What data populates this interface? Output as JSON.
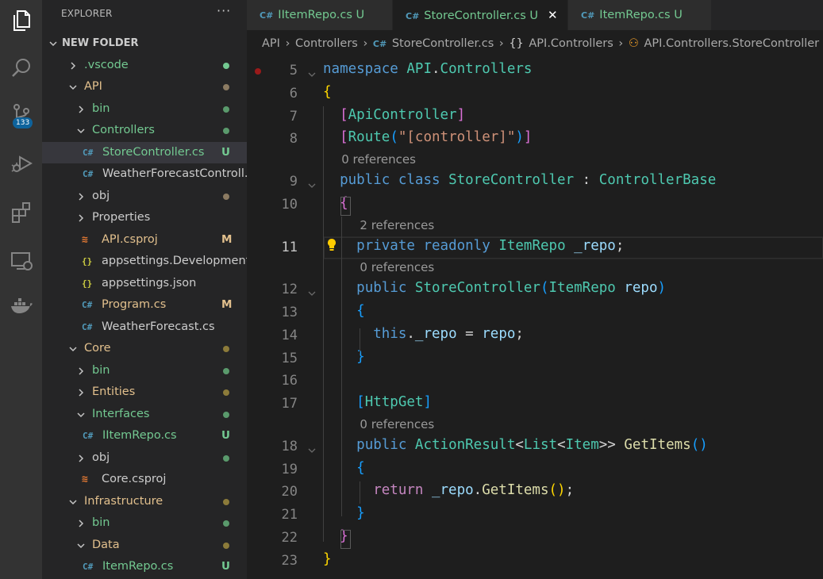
{
  "colors": {
    "git_untracked": "#73c991",
    "git_modified": "#e2c08d",
    "git_ignored": "#8c8c8c",
    "cs_icon": "#519aba",
    "xml_icon": "#e37933",
    "json_icon": "#cbcb41",
    "badge": "#0e639c"
  },
  "activity": {
    "source_control_badge": "133"
  },
  "sidebar": {
    "title": "EXPLORER",
    "more": "···",
    "rows": [
      {
        "label": "NEW FOLDER",
        "kind": "root",
        "depth": 0,
        "chev": "down"
      },
      {
        "label": ".vscode",
        "kind": "folder",
        "depth": 1,
        "chev": "right",
        "color": "#73c991",
        "dot": "#73c991"
      },
      {
        "label": "API",
        "kind": "folder",
        "depth": 1,
        "chev": "down",
        "color": "#e2c08d",
        "dot": "#8c7b62"
      },
      {
        "label": "bin",
        "kind": "folder",
        "depth": 2,
        "chev": "right",
        "color": "#73c991",
        "dot": "#5a9a6c"
      },
      {
        "label": "Controllers",
        "kind": "folder",
        "depth": 2,
        "chev": "down",
        "color": "#73c991",
        "dot": "#5a9a6c"
      },
      {
        "label": "StoreController.cs",
        "kind": "cs",
        "depth": 3,
        "color": "#73c991",
        "status": "U",
        "selected": true
      },
      {
        "label": "WeatherForecastControll...",
        "kind": "cs",
        "depth": 3,
        "color": "#cccccc"
      },
      {
        "label": "obj",
        "kind": "folder",
        "depth": 2,
        "chev": "right",
        "color": "#cccccc",
        "dot": "#8c7b62"
      },
      {
        "label": "Properties",
        "kind": "folder",
        "depth": 2,
        "chev": "right",
        "color": "#cccccc"
      },
      {
        "label": "API.csproj",
        "kind": "xml",
        "depth": 2,
        "color": "#e2c08d",
        "status": "M"
      },
      {
        "label": "appsettings.Development.j...",
        "kind": "json",
        "depth": 2,
        "color": "#cccccc"
      },
      {
        "label": "appsettings.json",
        "kind": "json",
        "depth": 2,
        "color": "#cccccc"
      },
      {
        "label": "Program.cs",
        "kind": "cs",
        "depth": 2,
        "color": "#e2c08d",
        "status": "M"
      },
      {
        "label": "WeatherForecast.cs",
        "kind": "cs",
        "depth": 2,
        "color": "#cccccc"
      },
      {
        "label": "Core",
        "kind": "folder",
        "depth": 1,
        "chev": "down",
        "color": "#e2c08d",
        "dot": "#8c7b3a"
      },
      {
        "label": "bin",
        "kind": "folder",
        "depth": 2,
        "chev": "right",
        "color": "#73c991",
        "dot": "#5a9a6c"
      },
      {
        "label": "Entities",
        "kind": "folder",
        "depth": 2,
        "chev": "right",
        "color": "#e2c08d",
        "dot": "#8c7b3a"
      },
      {
        "label": "Interfaces",
        "kind": "folder",
        "depth": 2,
        "chev": "down",
        "color": "#73c991",
        "dot": "#5a9a6c"
      },
      {
        "label": "IItemRepo.cs",
        "kind": "cs",
        "depth": 3,
        "color": "#73c991",
        "status": "U"
      },
      {
        "label": "obj",
        "kind": "folder",
        "depth": 2,
        "chev": "right",
        "color": "#cccccc",
        "dot": "#5a9a6c"
      },
      {
        "label": "Core.csproj",
        "kind": "xml",
        "depth": 2,
        "color": "#cccccc"
      },
      {
        "label": "Infrastructure",
        "kind": "folder",
        "depth": 1,
        "chev": "down",
        "color": "#e2c08d",
        "dot": "#8c7b3a"
      },
      {
        "label": "bin",
        "kind": "folder",
        "depth": 2,
        "chev": "right",
        "color": "#73c991",
        "dot": "#5a9a6c"
      },
      {
        "label": "Data",
        "kind": "folder",
        "depth": 2,
        "chev": "down",
        "color": "#e2c08d",
        "dot": "#8c7b3a"
      },
      {
        "label": "ItemRepo.cs",
        "kind": "cs",
        "depth": 3,
        "color": "#73c991",
        "status": "U"
      }
    ]
  },
  "tabs": [
    {
      "label": "IItemRepo.cs",
      "status": "U",
      "active": false
    },
    {
      "label": "StoreController.cs",
      "status": "U",
      "active": true,
      "close": "✕"
    },
    {
      "label": "ItemRepo.cs",
      "status": "U",
      "active": false
    }
  ],
  "breadcrumb": {
    "api": "API",
    "controllers": "Controllers",
    "file": "StoreController.cs",
    "ns": "API.Controllers",
    "cls": "API.Controllers.StoreController"
  },
  "editor": {
    "current_line": "11",
    "lines": [
      {
        "n": "5",
        "fold": true,
        "html": "<span class='kw'>namespace</span> <span class='ty'>API</span><span class='pl'>.</span><span class='ty'>Controllers</span>"
      },
      {
        "n": "6",
        "html": "<span class='br1'>{</span>"
      },
      {
        "n": "7",
        "html": "  <span class='br2'>[</span><span class='ty'>ApiController</span><span class='br2'>]</span>"
      },
      {
        "n": "8",
        "html": "  <span class='br2'>[</span><span class='ty'>Route</span><span class='br3'>(</span><span class='str'>\"[controller]\"</span><span class='br3'>)</span><span class='br2'>]</span>"
      },
      {
        "lens": "0 references",
        "indent": 1
      },
      {
        "n": "9",
        "fold": true,
        "html": "  <span class='kw'>public</span> <span class='kw'>class</span> <span class='ty'>StoreController</span> <span class='pl'>:</span> <span class='ty'>ControllerBase</span>"
      },
      {
        "n": "10",
        "html": "  <span class='br2'>{</span>"
      },
      {
        "lens": "2 references",
        "indent": 2
      },
      {
        "n": "11",
        "html": "    <span class='kw'>private</span> <span class='kw'>readonly</span> <span class='ty'>ItemRepo</span> <span class='vr'>_repo</span><span class='pl'>;</span>"
      },
      {
        "lens": "0 references",
        "indent": 2
      },
      {
        "n": "12",
        "fold": true,
        "html": "    <span class='kw'>public</span> <span class='ty'>StoreController</span><span class='br3'>(</span><span class='ty'>ItemRepo</span> <span class='vr'>repo</span><span class='br3'>)</span>"
      },
      {
        "n": "13",
        "html": "    <span class='br3'>{</span>"
      },
      {
        "n": "14",
        "html": "      <span class='kw'>this</span><span class='pl'>.</span><span class='vr'>_repo</span> <span class='pl'>=</span> <span class='vr'>repo</span><span class='pl'>;</span>"
      },
      {
        "n": "15",
        "html": "    <span class='br3'>}</span>"
      },
      {
        "n": "16",
        "html": ""
      },
      {
        "n": "17",
        "html": "    <span class='br3'>[</span><span class='ty'>HttpGet</span><span class='br3'>]</span>"
      },
      {
        "lens": "0 references",
        "indent": 2
      },
      {
        "n": "18",
        "fold": true,
        "html": "    <span class='kw'>public</span> <span class='ty'>ActionResult</span><span class='pl'>&lt;</span><span class='ty'>List</span><span class='pl'>&lt;</span><span class='ty'>Item</span><span class='pl'>&gt;&gt;</span> <span class='fn'>GetItems</span><span class='br3'>()</span>"
      },
      {
        "n": "19",
        "html": "    <span class='br3'>{</span>"
      },
      {
        "n": "20",
        "html": "      <span class='ctl'>return</span> <span class='vr'>_repo</span><span class='pl'>.</span><span class='fn'>GetItems</span><span class='br1'>()</span><span class='pl'>;</span>"
      },
      {
        "n": "21",
        "html": "    <span class='br3'>}</span>"
      },
      {
        "n": "22",
        "html": "  <span class='br2'>}</span>"
      },
      {
        "n": "23",
        "html": "<span class='br1'>}</span>"
      }
    ]
  }
}
